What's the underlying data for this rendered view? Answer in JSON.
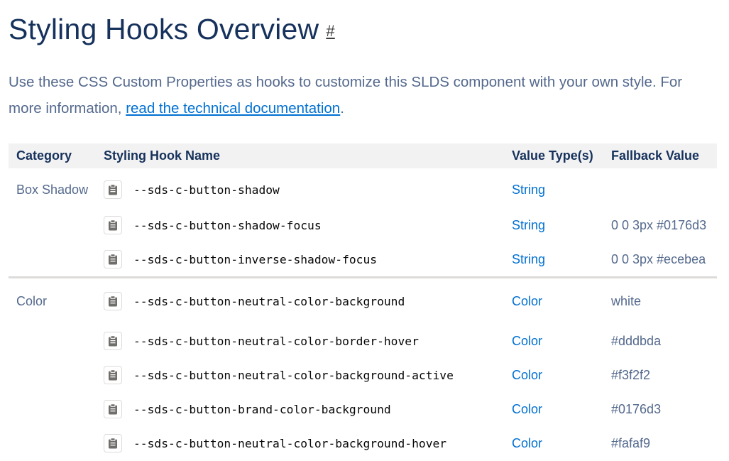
{
  "header": {
    "title": "Styling Hooks Overview",
    "anchor": "#"
  },
  "intro": {
    "text_before": "Use these CSS Custom Properties as hooks to customize this SLDS component with your own style. For more information, ",
    "link_text": "read the technical documentation",
    "text_after": "."
  },
  "table": {
    "columns": [
      "Category",
      "Styling Hook Name",
      "Value Type(s)",
      "Fallback Value"
    ],
    "groups": [
      {
        "category": "Box Shadow",
        "rows": [
          {
            "name": "--sds-c-button-shadow",
            "type": "String",
            "fallback": ""
          },
          {
            "name": "--sds-c-button-shadow-focus",
            "type": "String",
            "fallback": "0 0 3px #0176d3"
          },
          {
            "name": "--sds-c-button-inverse-shadow-focus",
            "type": "String",
            "fallback": "0 0 3px #ecebea"
          }
        ]
      },
      {
        "category": "Color",
        "rows": [
          {
            "name": "--sds-c-button-neutral-color-background",
            "type": "Color",
            "fallback": "white"
          },
          {
            "name": "--sds-c-button-neutral-color-border-hover",
            "type": "Color",
            "fallback": "#dddbda"
          },
          {
            "name": "--sds-c-button-neutral-color-background-active",
            "type": "Color",
            "fallback": "#f3f2f2"
          },
          {
            "name": "--sds-c-button-brand-color-background",
            "type": "Color",
            "fallback": "#0176d3"
          },
          {
            "name": "--sds-c-button-neutral-color-background-hover",
            "type": "Color",
            "fallback": "#fafaf9"
          }
        ]
      }
    ],
    "copy_icon": "clipboard-icon"
  },
  "colors": {
    "heading": "#16325c",
    "body_text": "#54698d",
    "link": "#0070d2",
    "header_row_bg": "#f3f2f2",
    "divider": "#dddbda"
  }
}
